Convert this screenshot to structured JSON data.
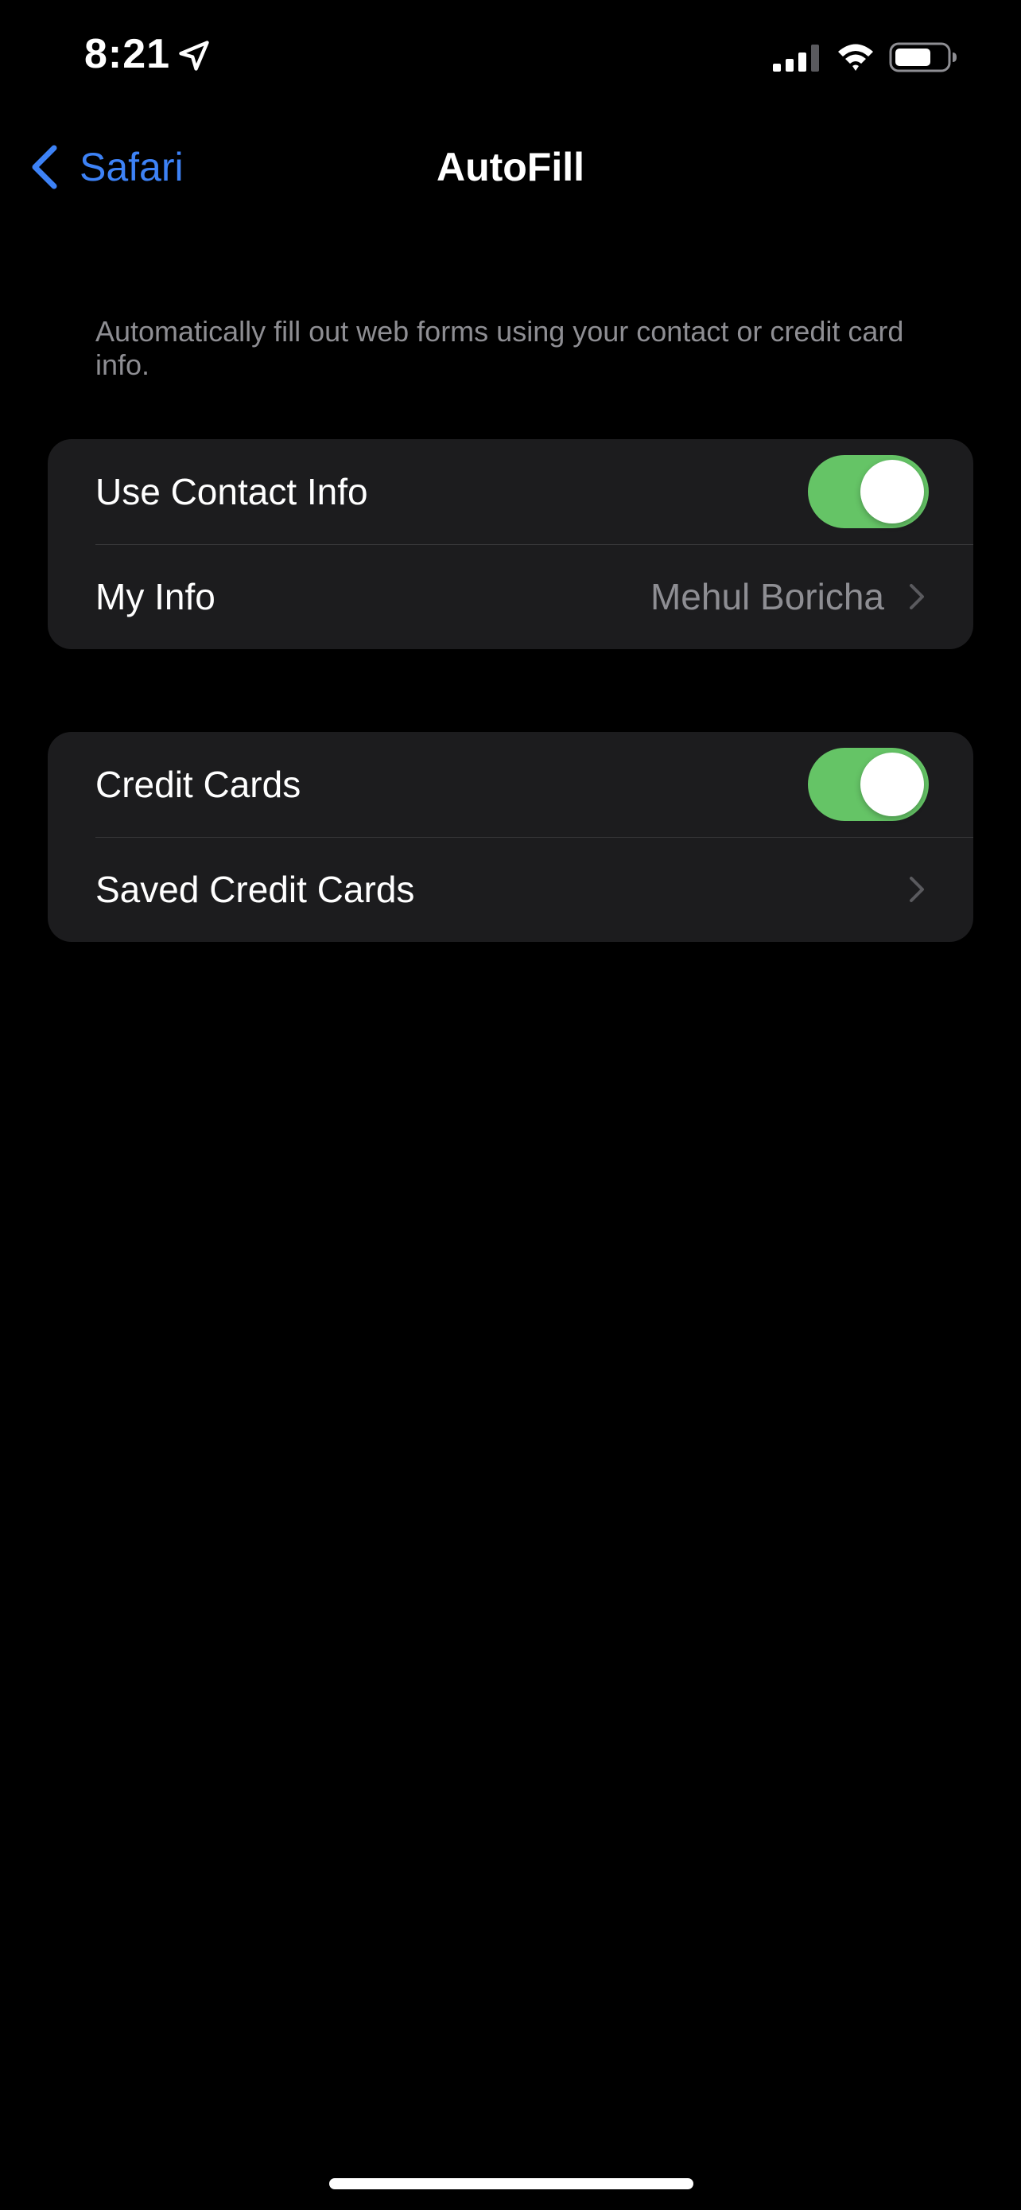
{
  "status_bar": {
    "time": "8:21",
    "icons": [
      "location-arrow-icon",
      "cellular-signal-icon",
      "wifi-icon",
      "battery-icon"
    ]
  },
  "nav": {
    "back_label": "Safari",
    "title": "AutoFill"
  },
  "description": "Automatically fill out web forms using your contact or credit card info.",
  "groups": [
    {
      "rows": [
        {
          "label": "Use Contact Info",
          "type": "toggle",
          "on": true
        },
        {
          "label": "My Info",
          "type": "link",
          "value": "Mehul Boricha"
        }
      ]
    },
    {
      "rows": [
        {
          "label": "Credit Cards",
          "type": "toggle",
          "on": true
        },
        {
          "label": "Saved Credit Cards",
          "type": "link",
          "value": ""
        }
      ]
    }
  ],
  "colors": {
    "background": "#000000",
    "cell": "#1c1c1e",
    "accent": "#3d82f6",
    "toggle_on": "#65c466",
    "secondary_text": "#8e8e93"
  }
}
